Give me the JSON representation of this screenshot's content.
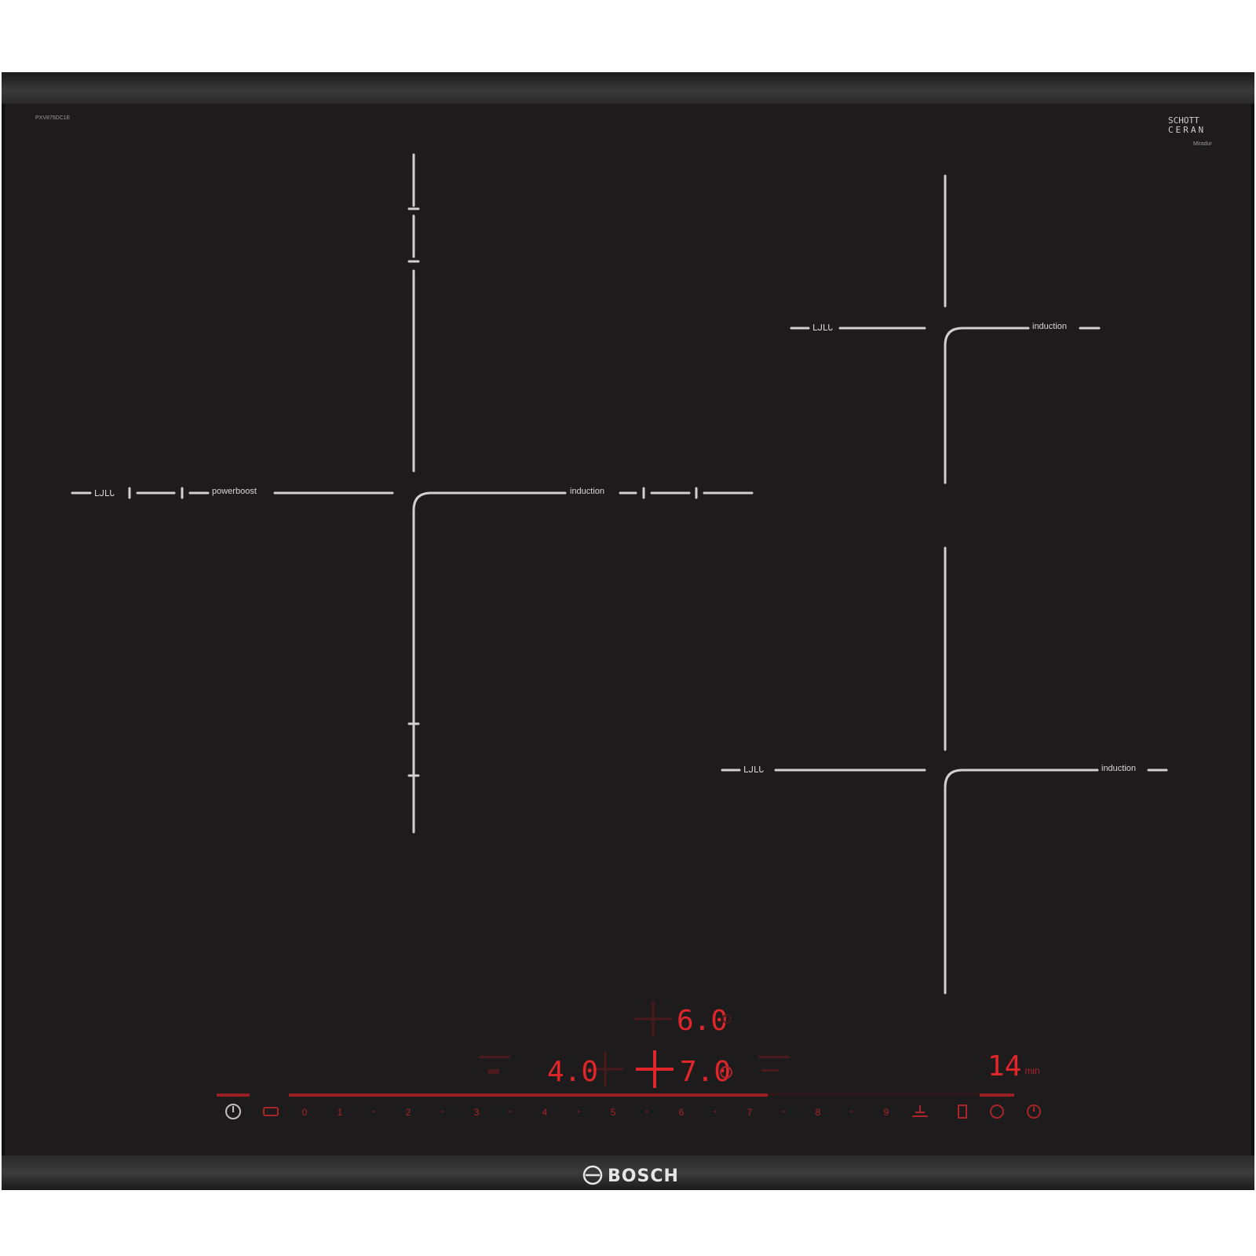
{
  "hob": {
    "model_code": "PXV875DC1E",
    "certification": {
      "line1": "SCHOTT",
      "line2": "CERAN",
      "line3": "Miradur"
    },
    "brand": "BOSCH"
  },
  "zones": {
    "left_flex": {
      "label_left": "ᒪᒍᒪᒐ",
      "label_boost": "powerboost",
      "label_right": "induction"
    },
    "right_top": {
      "label_left": "ᒪᒍᒪᒐ",
      "label_right": "induction"
    },
    "right_bottom": {
      "label_left": "ᒪᒍᒪᒐ",
      "label_right": "induction"
    }
  },
  "displays": {
    "top_value": "6.0",
    "left_value": "4.0",
    "center_value": "7.0",
    "timer_value": "14"
  },
  "slider": {
    "levels": [
      "0",
      "1",
      "2",
      "3",
      "4",
      "5",
      "6",
      "7",
      "8",
      "9"
    ]
  },
  "colors": {
    "glass": "#1e1b1c",
    "frame": "#111111",
    "marking": "#d0d0d0",
    "display_red": "#e0262b"
  },
  "icons": [
    "power-icon",
    "child-lock-icon",
    "boost-icon",
    "wipe-protection-icon",
    "timer-icon",
    "clock-icon"
  ]
}
